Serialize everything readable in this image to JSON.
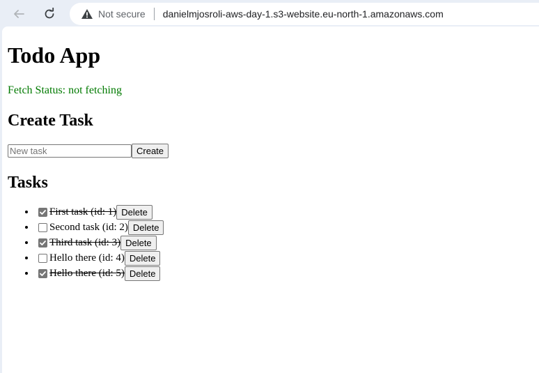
{
  "browser": {
    "security_label": "Not secure",
    "url": "danielmjosroli-aws-day-1.s3-website.eu-north-1.amazonaws.com"
  },
  "page": {
    "title": "Todo App",
    "fetch_status": "Fetch Status: not fetching",
    "create_heading": "Create Task",
    "input_placeholder": "New task",
    "input_value": "",
    "create_button": "Create",
    "tasks_heading": "Tasks",
    "delete_label": "Delete",
    "tasks": [
      {
        "label": "First task (id: 1)",
        "done": true
      },
      {
        "label": "Second task (id: 2)",
        "done": false
      },
      {
        "label": "Third task (id: 3)",
        "done": true
      },
      {
        "label": "Hello there (id: 4)",
        "done": false
      },
      {
        "label": "Hello there (id: 5)",
        "done": true
      }
    ]
  },
  "colors": {
    "status_green": "#007a00",
    "chrome_bg": "#e9eef6"
  },
  "icons": [
    "back-arrow-icon",
    "reload-icon",
    "warning-icon",
    "checkmark-icon"
  ]
}
